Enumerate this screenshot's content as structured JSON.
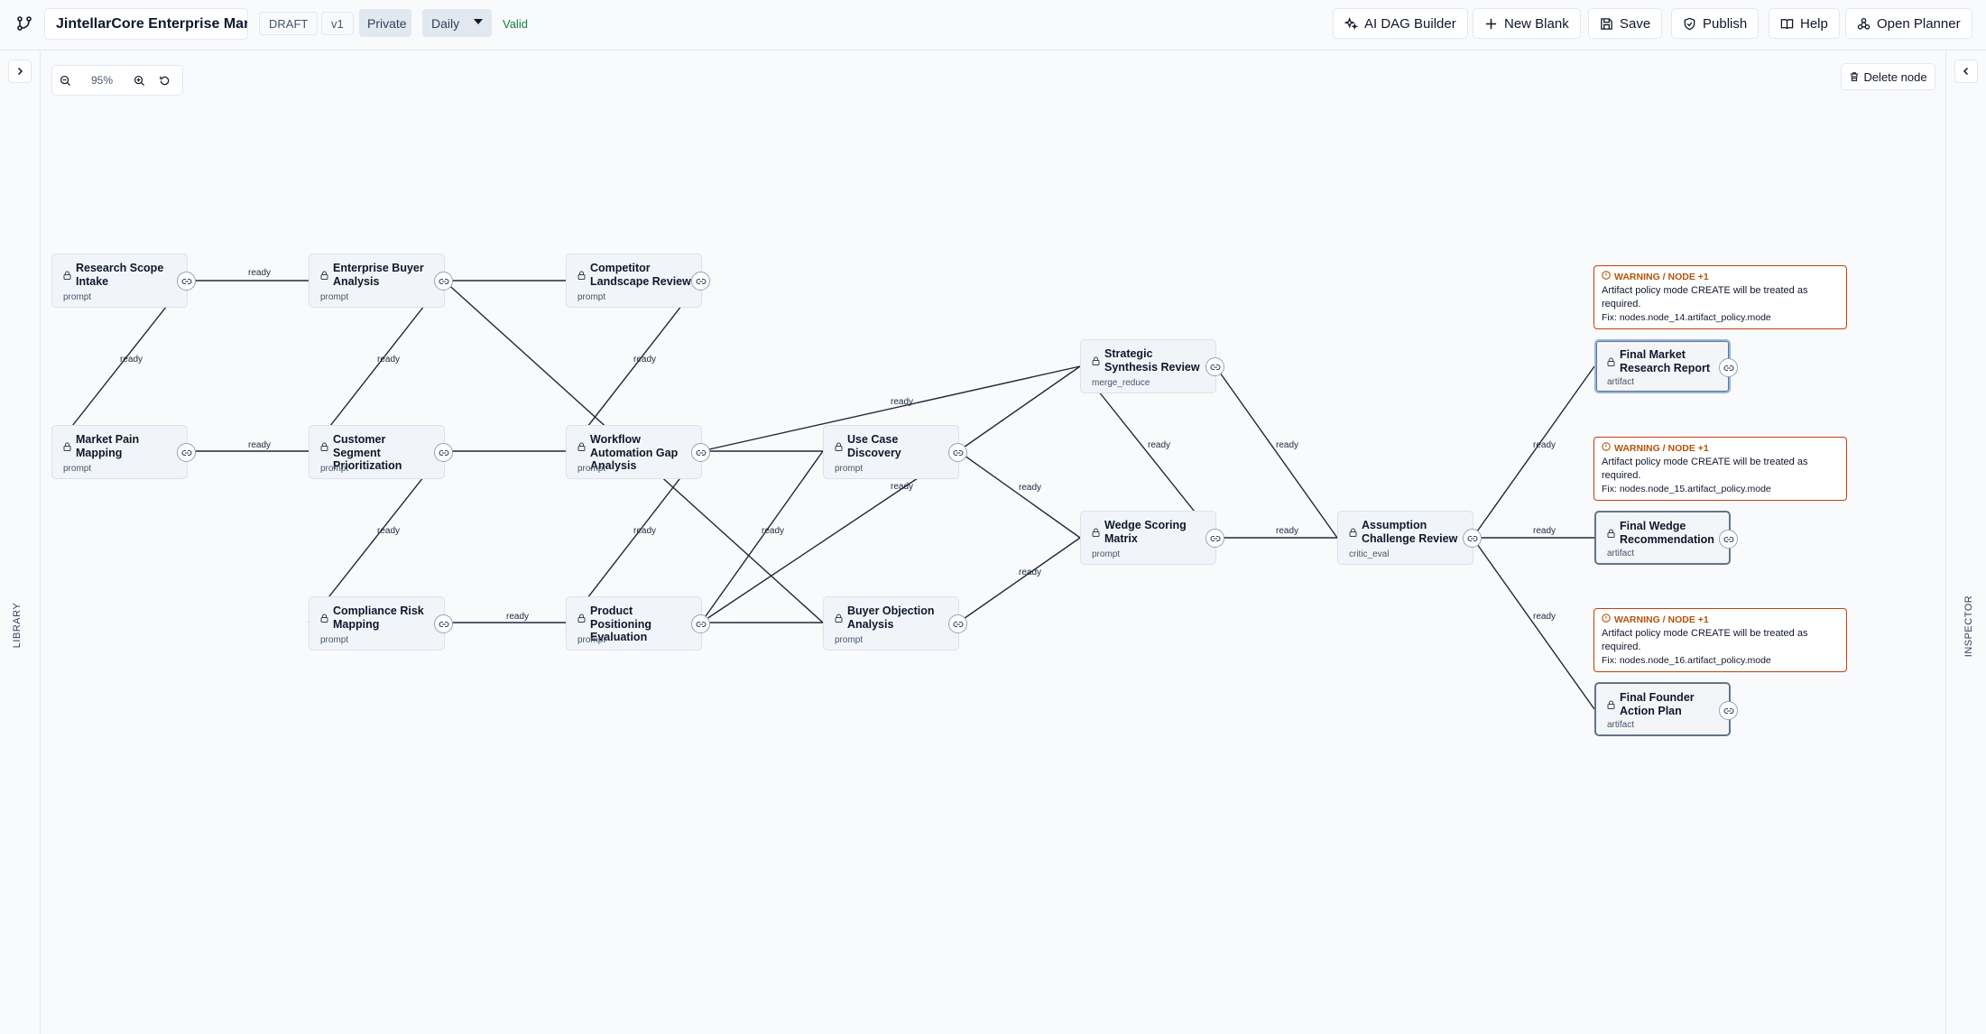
{
  "toolbar": {
    "title": "JintellarCore Enterprise Market Research",
    "status": "DRAFT",
    "version": "v1",
    "visibility": "Private",
    "schedule": "Daily",
    "validation": "Valid",
    "buttons": {
      "ai_dag_builder": "AI DAG Builder",
      "new_blank": "New Blank",
      "save": "Save",
      "publish": "Publish",
      "help": "Help",
      "open_planner": "Open Planner"
    }
  },
  "rails": {
    "left_label": "LIBRARY",
    "right_label": "INSPECTOR"
  },
  "canvas": {
    "zoom": "95%",
    "delete_node": "Delete node"
  },
  "nodes": [
    {
      "id": "n1",
      "title": "Research Scope Intake",
      "type": "prompt"
    },
    {
      "id": "n2",
      "title": "Enterprise Buyer Analysis",
      "type": "prompt"
    },
    {
      "id": "n3",
      "title": "Competitor Landscape Review",
      "type": "prompt"
    },
    {
      "id": "n4",
      "title": "Market Pain Mapping",
      "type": "prompt"
    },
    {
      "id": "n5",
      "title": "Customer Segment Prioritization",
      "type": "prompt"
    },
    {
      "id": "n6",
      "title": "Workflow Automation Gap Analysis",
      "type": "prompt"
    },
    {
      "id": "n7",
      "title": "Use Case Discovery",
      "type": "prompt"
    },
    {
      "id": "n8",
      "title": "Compliance Risk Mapping",
      "type": "prompt"
    },
    {
      "id": "n9",
      "title": "Product Positioning Evaluation",
      "type": "prompt"
    },
    {
      "id": "n10",
      "title": "Buyer Objection Analysis",
      "type": "prompt"
    },
    {
      "id": "n11",
      "title": "Strategic Synthesis Review",
      "type": "merge_reduce"
    },
    {
      "id": "n12",
      "title": "Wedge Scoring Matrix",
      "type": "prompt"
    },
    {
      "id": "n13",
      "title": "Assumption Challenge Review",
      "type": "critic_eval"
    },
    {
      "id": "n14",
      "title": "Final Market Research Report",
      "type": "artifact"
    },
    {
      "id": "n15",
      "title": "Final Wedge Recommendation",
      "type": "artifact"
    },
    {
      "id": "n16",
      "title": "Final Founder Action Plan",
      "type": "artifact"
    }
  ],
  "edge_label": "ready",
  "warnings": [
    {
      "header": "WARNING / NODE +1",
      "message": "Artifact policy mode CREATE will be treated as required.",
      "fix": "Fix: nodes.node_14.artifact_policy.mode"
    },
    {
      "header": "WARNING / NODE +1",
      "message": "Artifact policy mode CREATE will be treated as required.",
      "fix": "Fix: nodes.node_15.artifact_policy.mode"
    },
    {
      "header": "WARNING / NODE +1",
      "message": "Artifact policy mode CREATE will be treated as required.",
      "fix": "Fix: nodes.node_16.artifact_policy.mode"
    }
  ],
  "colors": {
    "accent": "#15803d",
    "warning": "#c2410c",
    "edge": "#1f2937"
  },
  "icons": [
    "flow-icon",
    "sparkles-icon",
    "plus-icon",
    "save-icon",
    "shield-icon",
    "book-icon",
    "planner-icon",
    "zoom-out-icon",
    "zoom-in-icon",
    "reset-icon",
    "trash-icon",
    "lock-icon",
    "link-icon",
    "alert-icon",
    "chevron-right-icon",
    "chevron-left-icon"
  ]
}
